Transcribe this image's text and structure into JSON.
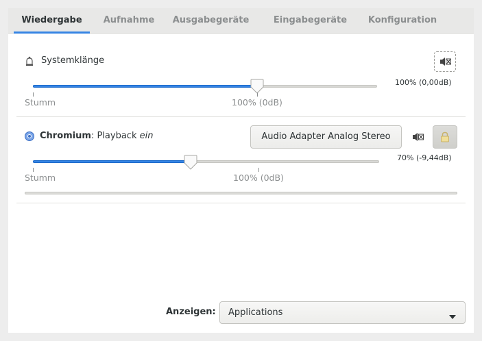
{
  "tabs": [
    {
      "label": "Wiedergabe",
      "active": true
    },
    {
      "label": "Aufnahme",
      "active": false
    },
    {
      "label": "Ausgabegeräte",
      "active": false
    },
    {
      "label": "Eingabegeräte",
      "active": false
    },
    {
      "label": "Konfiguration",
      "active": false
    }
  ],
  "streams": [
    {
      "title": "Systemklänge",
      "icon": "bell-icon",
      "volume_percent": 100,
      "volume_text": "100% (0,00dB)",
      "mute_label": "Stumm",
      "norm_label": "100% (0dB)"
    },
    {
      "app_name": "Chromium",
      "desc_prefix": ": Playback ",
      "desc_italic": "ein",
      "icon": "chromium-icon",
      "device_button": "Audio Adapter Analog Stereo",
      "volume_percent": 70,
      "volume_text": "70% (-9,44dB)",
      "mute_label": "Stumm",
      "norm_label": "100% (0dB)",
      "lock_channels": true
    }
  ],
  "footer": {
    "show_label": "Anzeigen:",
    "show_value": "Applications"
  },
  "colors": {
    "accent": "#3584e4",
    "accent_border": "#1b6acb",
    "text": "#2e3436",
    "dim": "#8b8e8f"
  }
}
